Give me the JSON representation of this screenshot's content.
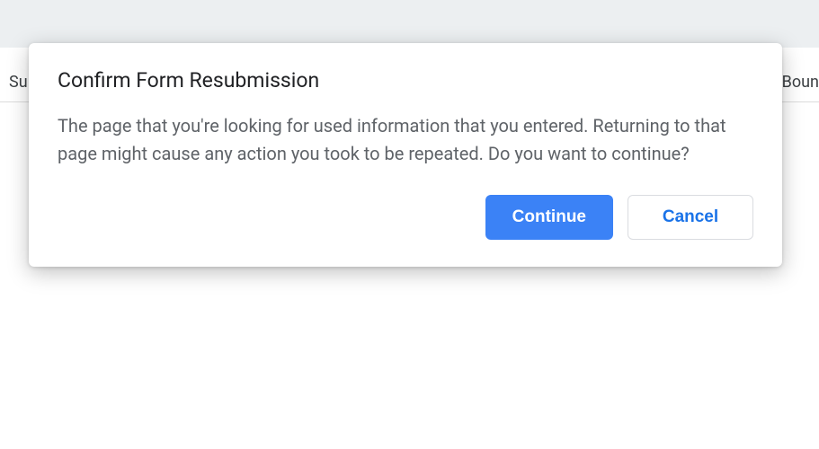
{
  "background": {
    "header_left_fragment": "Su",
    "header_right_fragment": "Boun"
  },
  "dialog": {
    "title": "Confirm Form Resubmission",
    "body": "The page that you're looking for used information that you entered. Returning to that page might cause any action you took to be repeated. Do you want to continue?",
    "continue_label": "Continue",
    "cancel_label": "Cancel"
  }
}
